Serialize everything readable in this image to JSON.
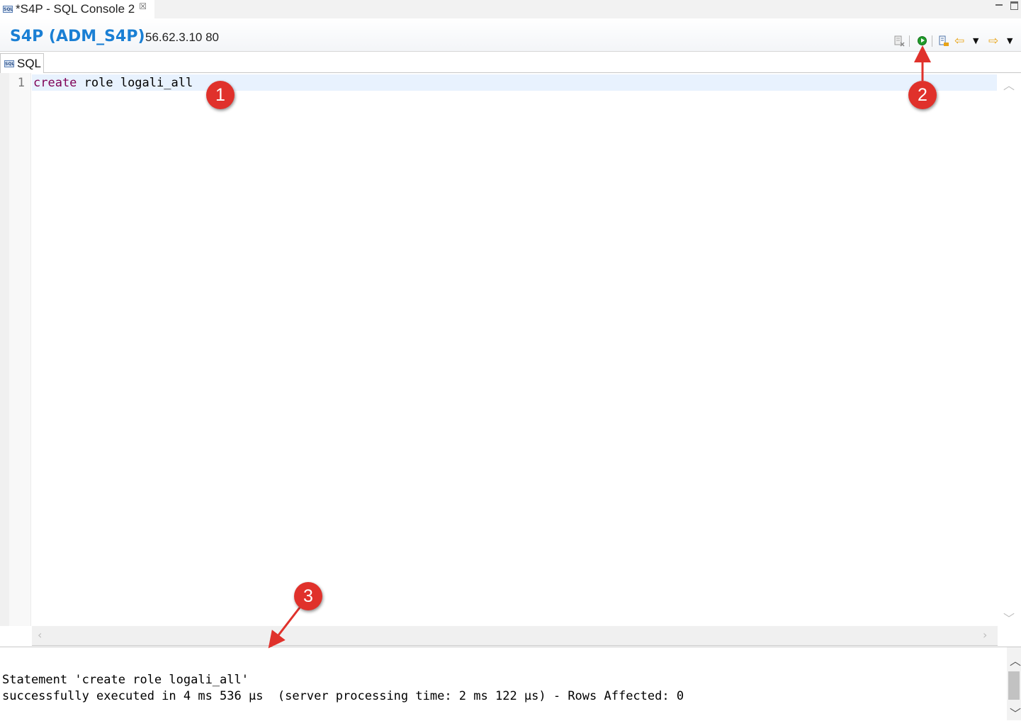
{
  "editor_tab": {
    "title": "*S4P - SQL Console 2",
    "close_glyph": "☒",
    "icon": "sql-icon"
  },
  "connection": {
    "name": "S4P (ADM_S4P)",
    "host": "56.62.3.10 80"
  },
  "toolbar": {
    "buttons": [
      "disconnect-icon",
      "execute-icon",
      "explain-plan-icon",
      "back-icon",
      "back-dropdown-icon",
      "forward-icon",
      "forward-dropdown-icon"
    ],
    "execute_color": "#1f9c2b",
    "nav_color": "#e8a317"
  },
  "sql_tab": {
    "label": "SQL"
  },
  "editor": {
    "line_number": "1",
    "keyword": "create",
    "rest": " role logali_all"
  },
  "result": {
    "line1": "Statement 'create role logali_all'",
    "line2": "successfully executed in 4 ms 536 µs  (server processing time: 2 ms 122 µs) - Rows Affected: 0"
  },
  "annotations": {
    "badge1": "1",
    "badge2": "2",
    "badge3": "3",
    "color": "#e0312b"
  }
}
